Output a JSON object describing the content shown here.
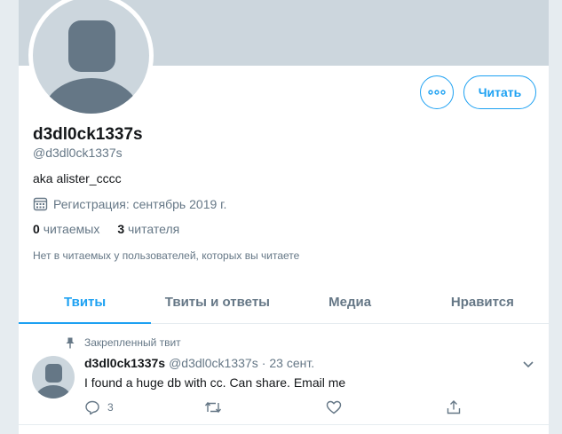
{
  "profile": {
    "name": "d3dl0ck1337s",
    "handle": "@d3dl0ck1337s",
    "bio": "aka alister_cccc",
    "joined": "Регистрация: сентябрь 2019 г.",
    "following_count": "0",
    "following_label": "читаемых",
    "followers_count": "3",
    "followers_label": "читателя",
    "mutual_text": "Нет в читаемых у пользователей, которых вы читаете"
  },
  "buttons": {
    "more_icon": "more-icon",
    "follow_label": "Читать"
  },
  "tabs": [
    {
      "label": "Твиты",
      "active": true
    },
    {
      "label": "Твиты и ответы",
      "active": false
    },
    {
      "label": "Медиа",
      "active": false
    },
    {
      "label": "Нравится",
      "active": false
    }
  ],
  "tweet": {
    "pinned_label": "Закрепленный твит",
    "name": "d3dl0ck1337s",
    "handle": "@d3dl0ck1337s",
    "separator": "·",
    "date": "23 сент.",
    "text": "I found a huge db with cc. Can share. Email me",
    "reply_count": "3"
  },
  "colors": {
    "accent": "#1da1f2",
    "banner": "#ccd6dd",
    "background": "#e6ecf0",
    "muted_text": "#657786",
    "avatar_silhouette": "#657786"
  }
}
